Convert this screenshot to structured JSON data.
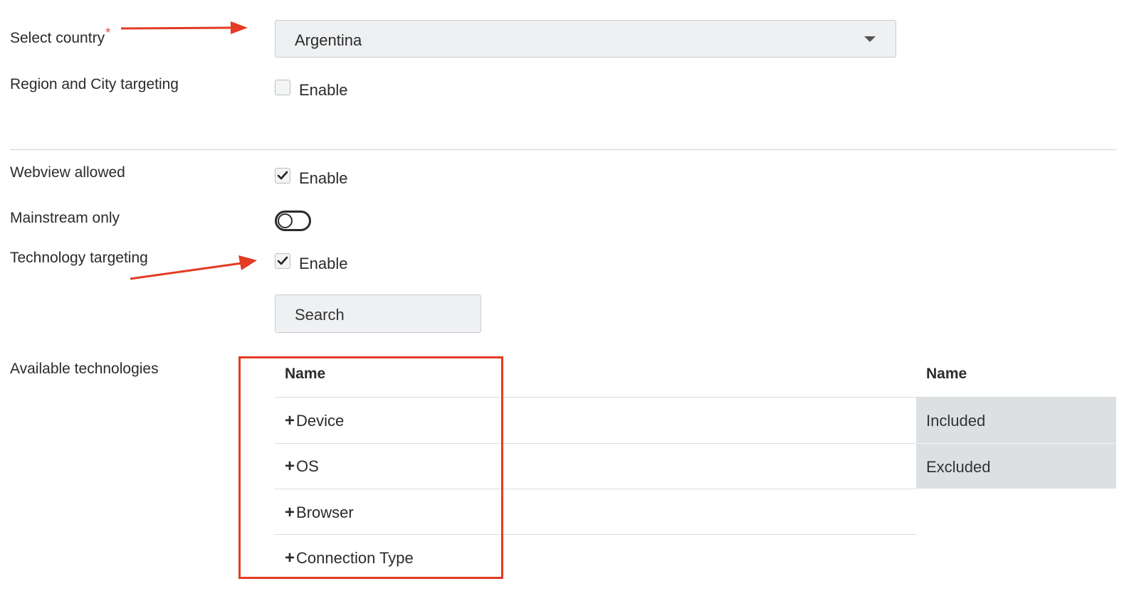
{
  "form": {
    "country_label": "Select country",
    "country_required": "*",
    "country_value": "Argentina",
    "region_label": "Region and City targeting",
    "region_enable": "Enable",
    "webview_label": "Webview allowed",
    "webview_enable": "Enable",
    "mainstream_label": "Mainstream only",
    "tech_label": "Technology targeting",
    "tech_enable": "Enable",
    "search_placeholder": "Search",
    "available_label": "Available technologies"
  },
  "states": {
    "region_checked": false,
    "webview_checked": true,
    "mainstream_on": false,
    "tech_checked": true
  },
  "available_table": {
    "header": "Name",
    "rows": [
      "Device",
      "OS",
      "Browser",
      "Connection Type"
    ]
  },
  "selected_table": {
    "header": "Name",
    "rows": [
      "Included",
      "Excluded"
    ]
  },
  "colors": {
    "annotation_red": "#e33b24",
    "field_bg": "#eef0f2"
  },
  "icons": {
    "dropdown": "caret-down",
    "expand": "plus",
    "check": "checkmark"
  }
}
